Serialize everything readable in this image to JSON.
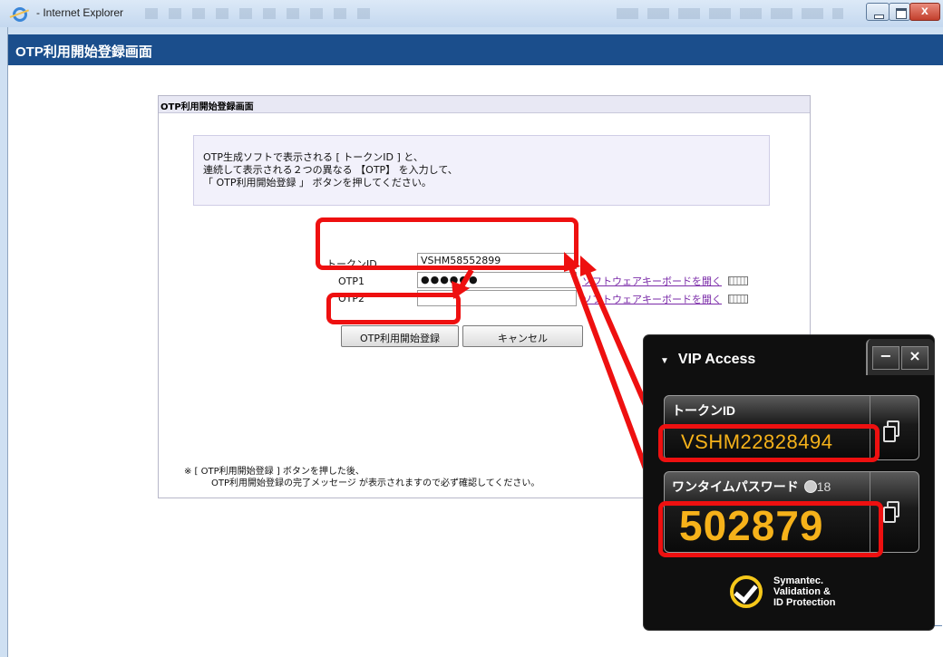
{
  "browser": {
    "title": "- Internet Explorer"
  },
  "page": {
    "header": "OTP利用開始登録画面",
    "panel_title": "OTP利用開始登録画面",
    "notice_lines": [
      "OTP生成ソフトで表示される [ トークンID ] と、",
      "連続して表示される２つの異なる 【OTP】 を入力して、",
      "「 OTP利用開始登録 」 ボタンを押してください。"
    ],
    "form": {
      "token_label": "トークンID",
      "token_value": "VSHM58552899",
      "otp1_label": "OTP1",
      "otp1_value": "●●●●●●",
      "otp2_label": "OTP2",
      "otp2_value": "",
      "keyboard_link_1": "ソフトウェアキーボードを開く",
      "keyboard_link_2": "ソフトウェアキーボードを開く"
    },
    "buttons": {
      "register": "OTP利用開始登録",
      "cancel": "キャンセル"
    },
    "footnote_lines": [
      "※ [ OTP利用開始登録 ] ボタンを押した後、",
      "OTP利用開始登録の完了メッセージ が表示されますので必ず確認してください。"
    ]
  },
  "vip_access": {
    "title": "VIP Access",
    "minimize": "−",
    "close": "×",
    "token_label": "トークンID",
    "token_id": "VSHM22828494",
    "otp_label": "ワンタイムパスワード",
    "timer": "18",
    "otp": "502879",
    "brand_lines": [
      "Symantec.",
      "Validation &",
      "ID Protection"
    ]
  },
  "colors": {
    "header_bg": "#1b4e8c",
    "highlight_red": "#ee1010",
    "vip_digits": "#f6b21a"
  }
}
